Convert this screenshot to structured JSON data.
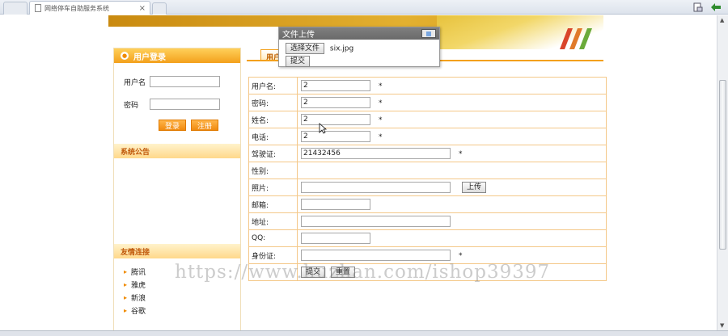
{
  "browser": {
    "tab_title": "网络停车自助服务系统",
    "close_glyph": "×"
  },
  "popup": {
    "title": "文件上传",
    "choose_file_label": "选择文件",
    "file_name": "six.jpg",
    "submit_label": "提交"
  },
  "sidebar": {
    "login_title": "用户登录",
    "username_label": "用户名",
    "password_label": "密码",
    "login_button": "登录",
    "register_button": "注册",
    "notice_title": "系统公告",
    "links_title": "友情连接",
    "links": [
      "腾讯",
      "雅虎",
      "新浪",
      "谷歌"
    ]
  },
  "main": {
    "tab_label": "用户",
    "fields": [
      {
        "label": "用户名:",
        "value": "2",
        "required": "*"
      },
      {
        "label": "密码:",
        "value": "2",
        "required": "*"
      },
      {
        "label": "姓名:",
        "value": "2",
        "required": "*"
      },
      {
        "label": "电话:",
        "value": "2",
        "required": "*"
      },
      {
        "label": "驾驶证:",
        "value": "21432456",
        "required": "*"
      },
      {
        "label": "性别:",
        "value": "",
        "required": ""
      },
      {
        "label": "照片:",
        "value": "",
        "required": "",
        "button": "上传"
      },
      {
        "label": "邮箱:",
        "value": "",
        "required": ""
      },
      {
        "label": "地址:",
        "value": "",
        "required": ""
      },
      {
        "label": "QQ:",
        "value": "",
        "required": ""
      },
      {
        "label": "身份证:",
        "value": "",
        "required": "*"
      }
    ],
    "submit_label": "提交",
    "reset_label": "重置"
  },
  "watermark": "https://www.huzhan.com/ishop39397",
  "colors": {
    "accent_orange": "#f3a01c",
    "table_border": "#f4c889",
    "popup_title_bg": "#6a6a6a"
  }
}
